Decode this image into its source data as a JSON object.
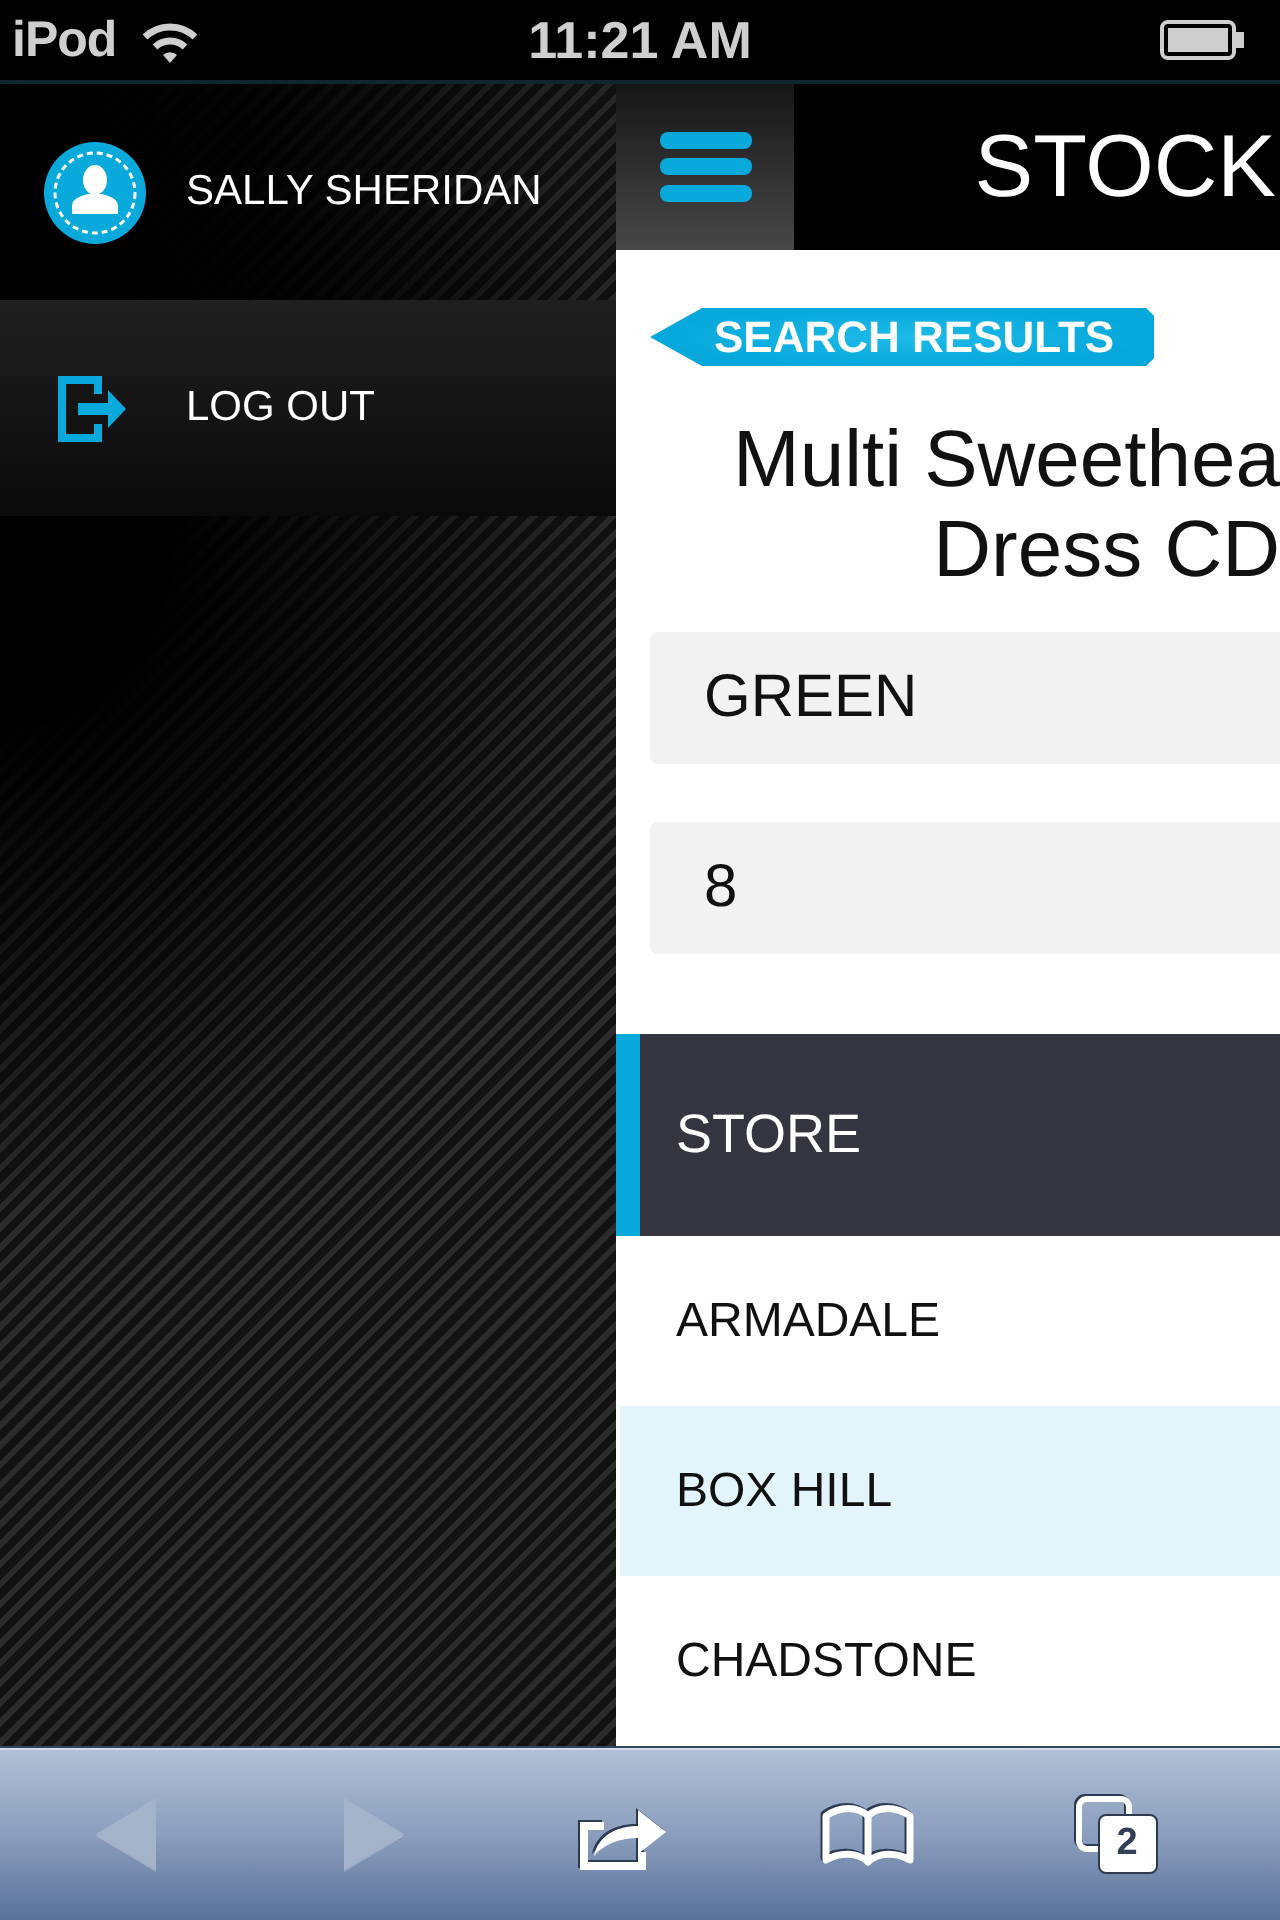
{
  "status_bar": {
    "carrier": "iPod",
    "time": "11:21 AM"
  },
  "sidebar": {
    "user": {
      "name": "SALLY SHERIDAN"
    },
    "items": [
      {
        "kind": "logout",
        "label": "LOG OUT"
      }
    ]
  },
  "header": {
    "title": "STOCK"
  },
  "back_button": {
    "label": "SEARCH RESULTS"
  },
  "product": {
    "title_lines": [
      "Multi Sweethea",
      "Dress CD"
    ]
  },
  "fields": [
    {
      "value": "GREEN"
    },
    {
      "value": "8"
    }
  ],
  "table": {
    "columns": [
      "STORE"
    ],
    "rows": [
      {
        "cells": [
          "ARMADALE"
        ],
        "selected": false
      },
      {
        "cells": [
          "BOX HILL"
        ],
        "selected": true
      },
      {
        "cells": [
          "CHADSTONE"
        ],
        "selected": false
      }
    ]
  },
  "toolbar": {
    "items": [
      {
        "kind": "back",
        "disabled": true
      },
      {
        "kind": "forward",
        "disabled": true
      },
      {
        "kind": "share",
        "disabled": false
      },
      {
        "kind": "bookmarks",
        "disabled": false
      },
      {
        "kind": "tabs",
        "disabled": false,
        "badge": "2"
      }
    ]
  }
}
